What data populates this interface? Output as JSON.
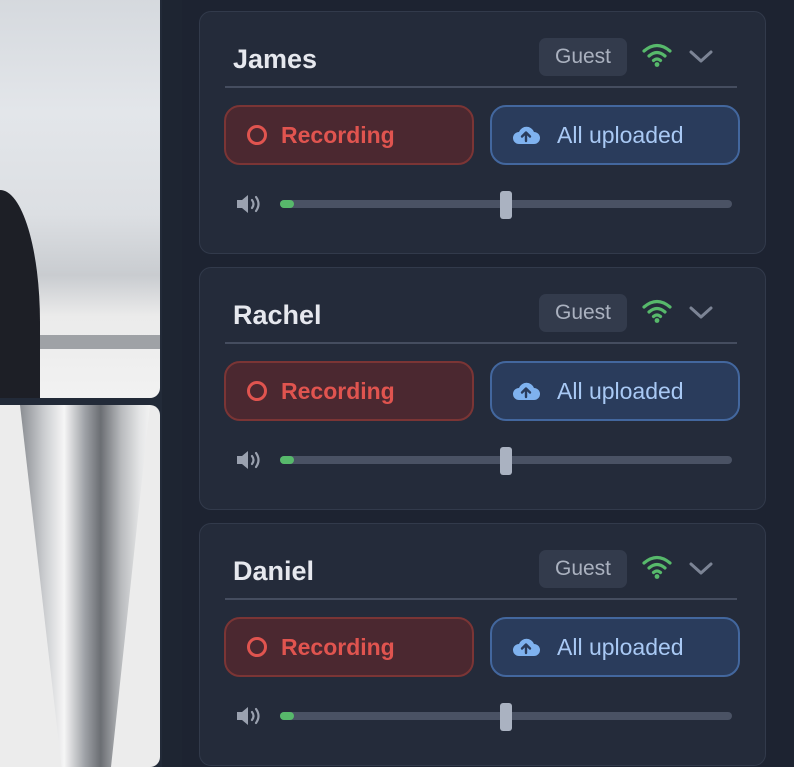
{
  "participants": [
    {
      "name": "James",
      "role": "Guest",
      "connection_icon": "wifi-icon",
      "recording_label": "Recording",
      "upload_label": "All uploaded",
      "mic_level": 0.03,
      "volume": 0.5
    },
    {
      "name": "Rachel",
      "role": "Guest",
      "connection_icon": "wifi-icon",
      "recording_label": "Recording",
      "upload_label": "All uploaded",
      "mic_level": 0.03,
      "volume": 0.5
    },
    {
      "name": "Daniel",
      "role": "Guest",
      "connection_icon": "wifi-icon",
      "recording_label": "Recording",
      "upload_label": "All uploaded",
      "mic_level": 0.03,
      "volume": 0.5
    }
  ],
  "colors": {
    "connection_good": "#57b96b",
    "recording": "#e0544f",
    "uploaded": "#a9c9f4"
  }
}
